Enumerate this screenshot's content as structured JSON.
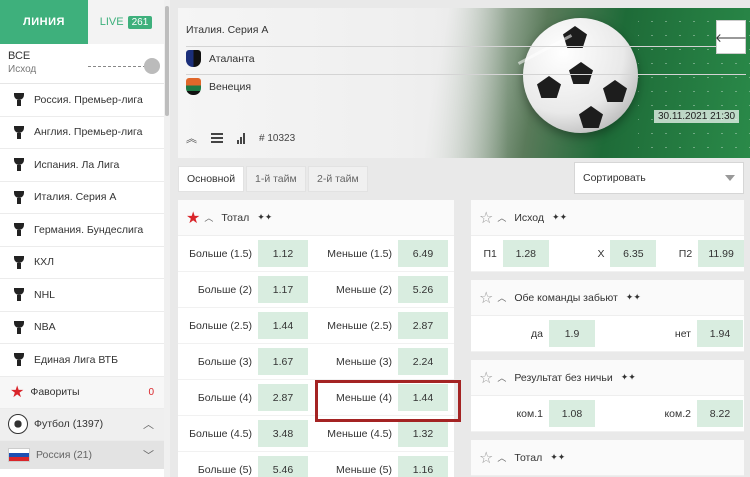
{
  "sidebar": {
    "tab_line": "ЛИНИЯ",
    "tab_live": "LIVE",
    "live_count": "261",
    "filter_title": "ВСЕ",
    "filter_sub": "Исход",
    "leagues": [
      "Россия. Премьер-лига",
      "Англия. Премьер-лига",
      "Испания. Ла Лига",
      "Италия. Серия А",
      "Германия. Бундеслига",
      "КХЛ",
      "NHL",
      "NBA",
      "Единая Лига ВТБ"
    ],
    "favorites": "Фавориты",
    "favorites_count": "0",
    "sport": "Футбол (1397)",
    "country": "Россия (21)"
  },
  "header": {
    "league": "Италия. Серия А",
    "team1": "Аталанта",
    "team2": "Венеция",
    "match_id": "# 10323",
    "datetime": "30.11.2021  21:30",
    "back_icon": "arrow-left-icon"
  },
  "filters": {
    "main": "Основной",
    "half1": "1-й тайм",
    "half2": "2-й тайм",
    "sort": "Сортировать"
  },
  "total_market": {
    "title": "Тотал",
    "rows": [
      {
        "over_label": "Больше (1.5)",
        "over": "1.12",
        "under_label": "Меньше (1.5)",
        "under": "6.49"
      },
      {
        "over_label": "Больше (2)",
        "over": "1.17",
        "under_label": "Меньше (2)",
        "under": "5.26"
      },
      {
        "over_label": "Больше (2.5)",
        "over": "1.44",
        "under_label": "Меньше (2.5)",
        "under": "2.87"
      },
      {
        "over_label": "Больше (3)",
        "over": "1.67",
        "under_label": "Меньше (3)",
        "under": "2.24"
      },
      {
        "over_label": "Больше (4)",
        "over": "2.87",
        "under_label": "Меньше (4)",
        "under": "1.44"
      },
      {
        "over_label": "Больше (4.5)",
        "over": "3.48",
        "under_label": "Меньше (4.5)",
        "under": "1.32"
      },
      {
        "over_label": "Больше (5)",
        "over": "5.46",
        "under_label": "Меньше (5)",
        "under": "1.16"
      }
    ]
  },
  "outcome_market": {
    "title": "Исход",
    "p1_label": "П1",
    "p1": "1.28",
    "x_label": "Х",
    "x": "6.35",
    "p2_label": "П2",
    "p2": "11.99"
  },
  "btts_market": {
    "title": "Обе команды забьют",
    "yes_label": "да",
    "yes": "1.9",
    "no_label": "нет",
    "no": "1.94"
  },
  "dnb_market": {
    "title": "Результат без ничьи",
    "t1_label": "ком.1",
    "t1": "1.08",
    "t2_label": "ком.2",
    "t2": "8.22"
  },
  "total_market_right": {
    "title": "Тотал"
  }
}
